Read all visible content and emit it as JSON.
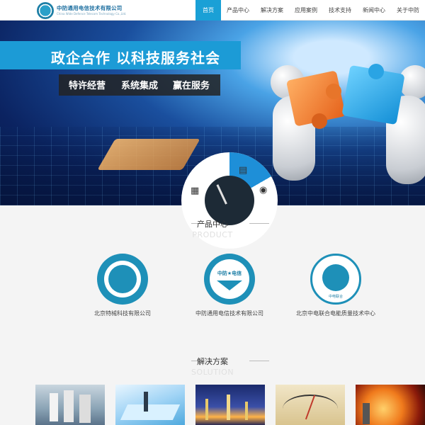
{
  "header": {
    "company_name": "中防通用电信技术有限公司",
    "company_name_en": "China Wide Defence Telecom Technology Co.,Ltd.",
    "nav": [
      "首页",
      "产品中心",
      "解决方案",
      "应用案例",
      "技术支持",
      "新闻中心",
      "关于中防"
    ],
    "active_nav": "首页"
  },
  "banner": {
    "slogan": "政企合作 以科技服务社会",
    "features": [
      "特许经营",
      "系统集成",
      "赢在服务"
    ]
  },
  "products": {
    "title": "产品中心",
    "title_en": "PRODUCT",
    "partners": [
      {
        "name": "北京特械科技有限公司"
      },
      {
        "name": "中防通用电信技术有限公司",
        "badge_text": "中防★电信"
      },
      {
        "name": "北京中电联合电能质量技术中心",
        "badge_text": "中电联合"
      }
    ]
  },
  "solutions": {
    "title": "解决方案",
    "title_en": "SOLUTION"
  },
  "colors": {
    "accent": "#1aa0d6",
    "logo_blue": "#1d6fa0"
  }
}
